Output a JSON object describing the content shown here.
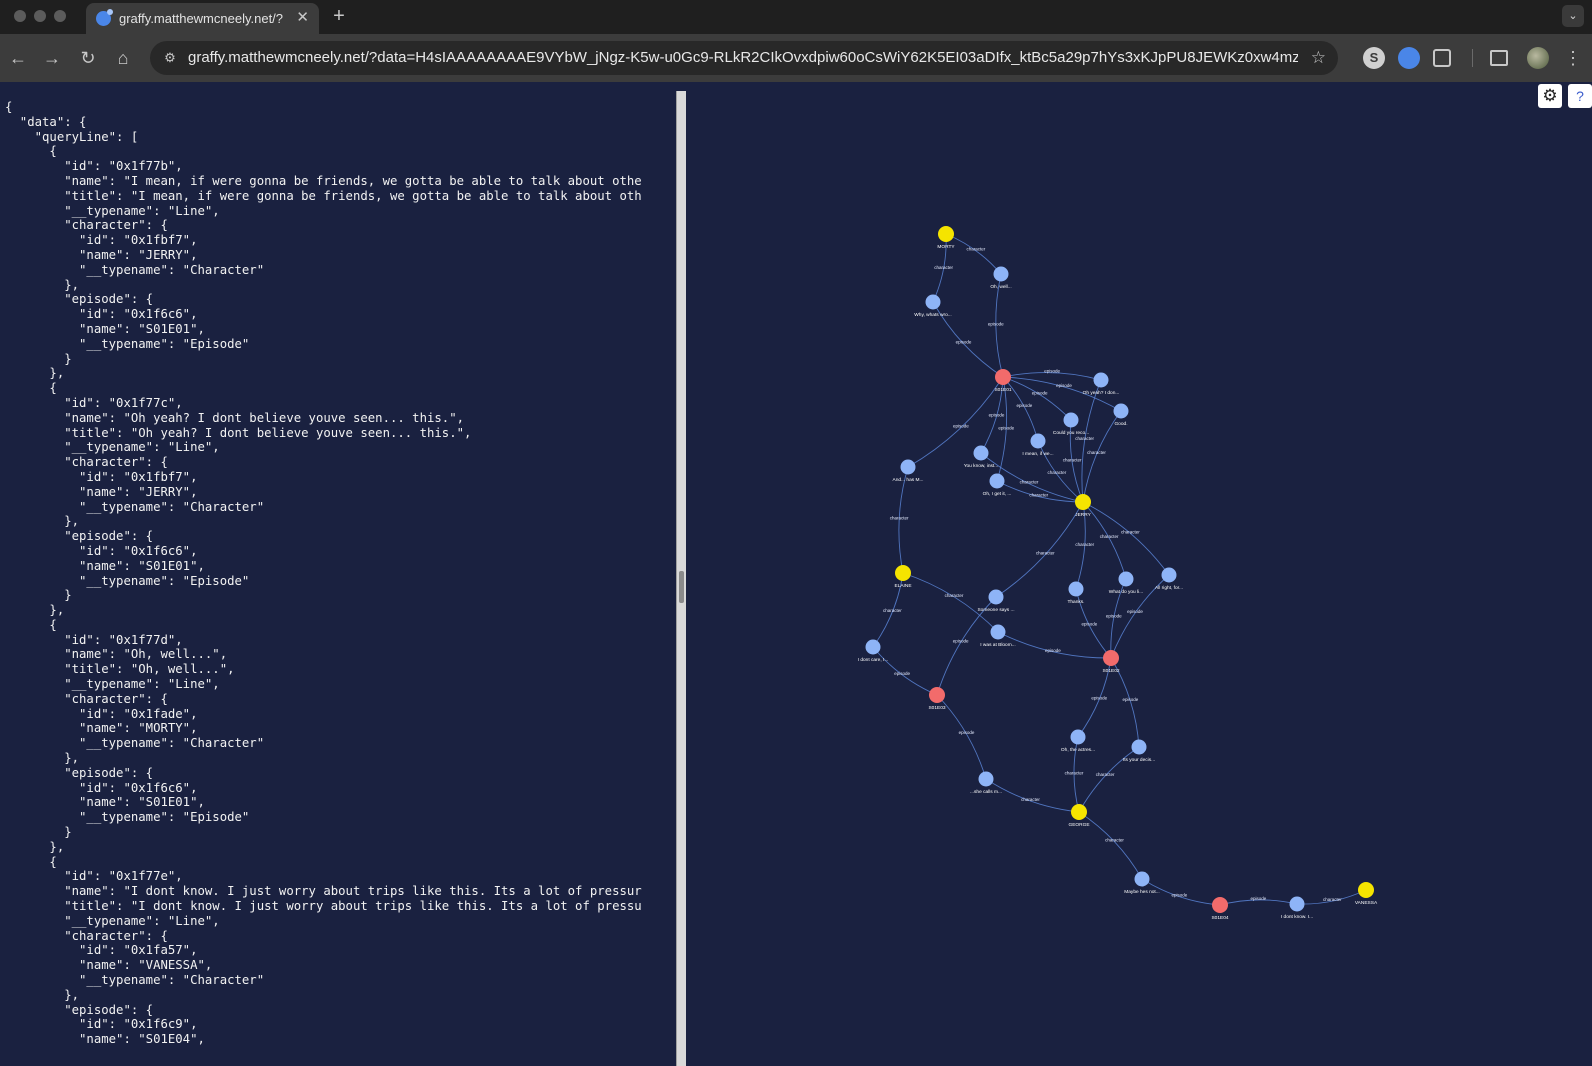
{
  "browser": {
    "tab_title": "graffy.matthewmcneely.net/?",
    "new_tab_label": "+",
    "close_label": "✕",
    "url": "graffy.matthewmcneely.net/?data=H4sIAAAAAAAAE9VYbW_jNgz-K5w-u0Gc9-RLkR2CIkOvxdpiw60oCsWiY62K5EI03aDIfx_ktBc5a29p7hYs3xKJpPU8JEWKz0xw4mz0z...",
    "back": "←",
    "forward": "→",
    "reload": "↻",
    "home": "⌂",
    "star": "☆",
    "menu": "⋮",
    "ext_s": "S"
  },
  "editor": {
    "json_text": "{\n  \"data\": {\n    \"queryLine\": [\n      {\n        \"id\": \"0x1f77b\",\n        \"name\": \"I mean, if were gonna be friends, we gotta be able to talk about othe\n        \"title\": \"I mean, if were gonna be friends, we gotta be able to talk about oth\n        \"__typename\": \"Line\",\n        \"character\": {\n          \"id\": \"0x1fbf7\",\n          \"name\": \"JERRY\",\n          \"__typename\": \"Character\"\n        },\n        \"episode\": {\n          \"id\": \"0x1f6c6\",\n          \"name\": \"S01E01\",\n          \"__typename\": \"Episode\"\n        }\n      },\n      {\n        \"id\": \"0x1f77c\",\n        \"name\": \"Oh yeah? I dont believe youve seen... this.\",\n        \"title\": \"Oh yeah? I dont believe youve seen... this.\",\n        \"__typename\": \"Line\",\n        \"character\": {\n          \"id\": \"0x1fbf7\",\n          \"name\": \"JERRY\",\n          \"__typename\": \"Character\"\n        },\n        \"episode\": {\n          \"id\": \"0x1f6c6\",\n          \"name\": \"S01E01\",\n          \"__typename\": \"Episode\"\n        }\n      },\n      {\n        \"id\": \"0x1f77d\",\n        \"name\": \"Oh, well...\",\n        \"title\": \"Oh, well...\",\n        \"__typename\": \"Line\",\n        \"character\": {\n          \"id\": \"0x1fade\",\n          \"name\": \"MORTY\",\n          \"__typename\": \"Character\"\n        },\n        \"episode\": {\n          \"id\": \"0x1f6c6\",\n          \"name\": \"S01E01\",\n          \"__typename\": \"Episode\"\n        }\n      },\n      {\n        \"id\": \"0x1f77e\",\n        \"name\": \"I dont know. I just worry about trips like this. Its a lot of pressur\n        \"title\": \"I dont know. I just worry about trips like this. Its a lot of pressu\n        \"__typename\": \"Line\",\n        \"character\": {\n          \"id\": \"0x1fa57\",\n          \"name\": \"VANESSA\",\n          \"__typename\": \"Character\"\n        },\n        \"episode\": {\n          \"id\": \"0x1f6c9\",\n          \"name\": \"S01E04\","
  },
  "graph_controls": {
    "settings": "⚙",
    "help": "?"
  },
  "colors": {
    "character": "#f5e400",
    "episode": "#f26b6b",
    "line": "#8eb4f7",
    "edge": "#5b84d6"
  },
  "graph": {
    "nodes": [
      {
        "id": "morty",
        "type": "character",
        "label": "MORTY"
      },
      {
        "id": "jerry",
        "type": "character",
        "label": "JERRY"
      },
      {
        "id": "elaine",
        "type": "character",
        "label": "ELAINE"
      },
      {
        "id": "george",
        "type": "character",
        "label": "GEORGE"
      },
      {
        "id": "vanessa",
        "type": "character",
        "label": "VANESSA"
      },
      {
        "id": "s01e01",
        "type": "episode",
        "label": "S01E01"
      },
      {
        "id": "s01e02",
        "type": "episode",
        "label": "S01E02"
      },
      {
        "id": "s01e03",
        "type": "episode",
        "label": "S01E03"
      },
      {
        "id": "s01e04",
        "type": "episode",
        "label": "S01E04"
      },
      {
        "id": "l_ohwell",
        "type": "line",
        "label": "Oh, well..."
      },
      {
        "id": "l_whywhats",
        "type": "line",
        "label": "Why, whats wro..."
      },
      {
        "id": "l_ohyeah",
        "type": "line",
        "label": "Oh yeah? I don..."
      },
      {
        "id": "l_good",
        "type": "line",
        "label": "Good."
      },
      {
        "id": "l_couldyou",
        "type": "line",
        "label": "Could you reco..."
      },
      {
        "id": "l_imean",
        "type": "line",
        "label": "I mean, if we..."
      },
      {
        "id": "l_youknow",
        "type": "line",
        "label": "You know, inst..."
      },
      {
        "id": "l_andhas",
        "type": "line",
        "label": "And... has M..."
      },
      {
        "id": "l_ohiget",
        "type": "line",
        "label": "Oh, I get it, ..."
      },
      {
        "id": "l_someone",
        "type": "line",
        "label": "Someone says ..."
      },
      {
        "id": "l_thanks",
        "type": "line",
        "label": "Thanks."
      },
      {
        "id": "l_whatdoyou",
        "type": "line",
        "label": "What do you li..."
      },
      {
        "id": "l_allright",
        "type": "line",
        "label": "All right, for..."
      },
      {
        "id": "l_iwasat",
        "type": "line",
        "label": "I was at Bloom..."
      },
      {
        "id": "l_idontcare",
        "type": "line",
        "label": "I dont care, I..."
      },
      {
        "id": "l_ohtheactress",
        "type": "line",
        "label": "Oh, the actres..."
      },
      {
        "id": "l_itsyourdecis",
        "type": "line",
        "label": "Its your decis..."
      },
      {
        "id": "l_shecalls",
        "type": "line",
        "label": "...she calls m..."
      },
      {
        "id": "l_maybehes",
        "type": "line",
        "label": "Maybe hes not..."
      },
      {
        "id": "l_idontknow",
        "type": "line",
        "label": "I dont know. I..."
      }
    ],
    "edges": [
      {
        "source": "l_ohwell",
        "target": "morty",
        "label": "character"
      },
      {
        "source": "l_whywhats",
        "target": "morty",
        "label": "character"
      },
      {
        "source": "l_ohwell",
        "target": "s01e01",
        "label": "episode"
      },
      {
        "source": "l_whywhats",
        "target": "s01e01",
        "label": "episode"
      },
      {
        "source": "l_ohyeah",
        "target": "s01e01",
        "label": "episode"
      },
      {
        "source": "l_good",
        "target": "s01e01",
        "label": "episode"
      },
      {
        "source": "l_couldyou",
        "target": "s01e01",
        "label": "episode"
      },
      {
        "source": "l_imean",
        "target": "s01e01",
        "label": "episode"
      },
      {
        "source": "l_youknow",
        "target": "s01e01",
        "label": "episode"
      },
      {
        "source": "l_andhas",
        "target": "s01e01",
        "label": "episode"
      },
      {
        "source": "l_ohiget",
        "target": "s01e01",
        "label": "episode"
      },
      {
        "source": "l_ohyeah",
        "target": "jerry",
        "label": "character"
      },
      {
        "source": "l_good",
        "target": "jerry",
        "label": "character"
      },
      {
        "source": "l_couldyou",
        "target": "jerry",
        "label": "character"
      },
      {
        "source": "l_imean",
        "target": "jerry",
        "label": "character"
      },
      {
        "source": "l_youknow",
        "target": "jerry",
        "label": "character"
      },
      {
        "source": "l_ohiget",
        "target": "jerry",
        "label": "character"
      },
      {
        "source": "l_someone",
        "target": "jerry",
        "label": "character"
      },
      {
        "source": "l_thanks",
        "target": "jerry",
        "label": "character"
      },
      {
        "source": "l_whatdoyou",
        "target": "jerry",
        "label": "character"
      },
      {
        "source": "l_allright",
        "target": "jerry",
        "label": "character"
      },
      {
        "source": "l_andhas",
        "target": "elaine",
        "label": "character"
      },
      {
        "source": "l_iwasat",
        "target": "elaine",
        "label": "character"
      },
      {
        "source": "l_idontcare",
        "target": "elaine",
        "label": "character"
      },
      {
        "source": "l_thanks",
        "target": "s01e02",
        "label": "episode"
      },
      {
        "source": "l_whatdoyou",
        "target": "s01e02",
        "label": "episode"
      },
      {
        "source": "l_allright",
        "target": "s01e02",
        "label": "episode"
      },
      {
        "source": "l_iwasat",
        "target": "s01e02",
        "label": "episode"
      },
      {
        "source": "l_ohtheactress",
        "target": "s01e02",
        "label": "episode"
      },
      {
        "source": "l_itsyourdecis",
        "target": "s01e02",
        "label": "episode"
      },
      {
        "source": "l_someone",
        "target": "s01e03",
        "label": "episode"
      },
      {
        "source": "l_idontcare",
        "target": "s01e03",
        "label": "episode"
      },
      {
        "source": "l_shecalls",
        "target": "s01e03",
        "label": "episode"
      },
      {
        "source": "l_ohtheactress",
        "target": "george",
        "label": "character"
      },
      {
        "source": "l_itsyourdecis",
        "target": "george",
        "label": "character"
      },
      {
        "source": "l_shecalls",
        "target": "george",
        "label": "character"
      },
      {
        "source": "l_maybehes",
        "target": "george",
        "label": "character"
      },
      {
        "source": "l_maybehes",
        "target": "s01e04",
        "label": "episode"
      },
      {
        "source": "l_idontknow",
        "target": "s01e04",
        "label": "episode"
      },
      {
        "source": "l_idontknow",
        "target": "vanessa",
        "label": "character"
      }
    ]
  }
}
